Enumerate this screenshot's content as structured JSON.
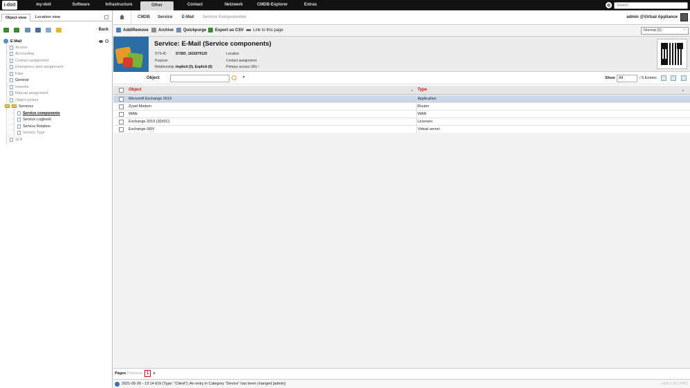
{
  "app": {
    "logo_text": "i-doit"
  },
  "topnav": {
    "items": [
      {
        "label": "my-doit"
      },
      {
        "label": "Software"
      },
      {
        "label": "Infrastructure"
      },
      {
        "label": "Other",
        "active": true
      },
      {
        "label": "Contact"
      },
      {
        "label": "Netzwerk"
      },
      {
        "label": "CMDB-Explorer"
      },
      {
        "label": "Extras"
      }
    ],
    "search_placeholder": "Search..."
  },
  "leftpanel": {
    "tabs": [
      {
        "label": "Object view"
      },
      {
        "label": "Location view"
      }
    ],
    "back_label": "Back",
    "tree": {
      "root": "E-Mail",
      "items": [
        {
          "label": "Access"
        },
        {
          "label": "Accounting"
        },
        {
          "label": "Contact assignment"
        },
        {
          "label": "Emergency plan assignment"
        },
        {
          "label": "Files"
        },
        {
          "label": "General"
        },
        {
          "label": "Inventor"
        },
        {
          "label": "Manual assignment"
        },
        {
          "label": "Object picture"
        },
        {
          "label": "Services"
        },
        {
          "label": "Service components"
        },
        {
          "label": "Service Logbook"
        },
        {
          "label": "Service Relation"
        },
        {
          "label": "Service Type"
        },
        {
          "label": "SLA"
        }
      ]
    }
  },
  "breadcrumb": {
    "items": [
      {
        "label": "CMDB"
      },
      {
        "label": "Service"
      },
      {
        "label": "E-Mail"
      },
      {
        "label": "Service Komponenten"
      }
    ],
    "user": "admin  @Virtual Appliance"
  },
  "toolbar": {
    "buttons": [
      {
        "label": "Add/Remove",
        "icon": "add-remove-icon"
      },
      {
        "label": "Archive",
        "icon": "archive-icon"
      },
      {
        "label": "Quickpurge",
        "icon": "quickpurge-icon"
      },
      {
        "label": "Export as CSV",
        "icon": "csv-icon"
      },
      {
        "label": "Link to this page",
        "icon": "link-icon"
      }
    ],
    "status": "Normal (5)"
  },
  "header": {
    "title": "Service: E-Mail (Service components)",
    "sysid_label": "SYS-ID",
    "sysid_value": "SYSID_1621870125",
    "purpose_label": "Purpose",
    "relationship_label": "Relationship",
    "relationship_value": "Implicit (3), Explicit (0)",
    "location_label": "Location",
    "contact_label": "Contact assignment",
    "access_label": "Primary access URL",
    "access_caret": "⌄"
  },
  "filter": {
    "label": "Object",
    "show_label": "Show",
    "show_value": "All",
    "entries": "/ 5 Entries"
  },
  "table": {
    "columns": [
      "Object",
      "Type"
    ],
    "rows": [
      {
        "object": "Microsoft Exchange 2019",
        "type": "Application",
        "selected": true
      },
      {
        "object": "Zyxel Modem",
        "type": "Router"
      },
      {
        "object": "WAN",
        "type": "WAN"
      },
      {
        "object": "Exchange 2019 (3DISC)",
        "type": "Licenses"
      },
      {
        "object": "Exchange-SRV",
        "type": "Virtual server"
      }
    ]
  },
  "pager": {
    "label": "Pages",
    "prev": "Previous",
    "current": "1",
    "next": "▸"
  },
  "statusbar": {
    "message": "2021-05-26 - 13:14 ESt (Type: \"Client\"): An entry in Category \"Device\" has been changed [admin]",
    "version": "i-doit 1.16.2 PRO"
  },
  "colors": {
    "accent": "#c4161c",
    "nav_bg": "#121212",
    "selected_row": "#c9d7e8"
  }
}
